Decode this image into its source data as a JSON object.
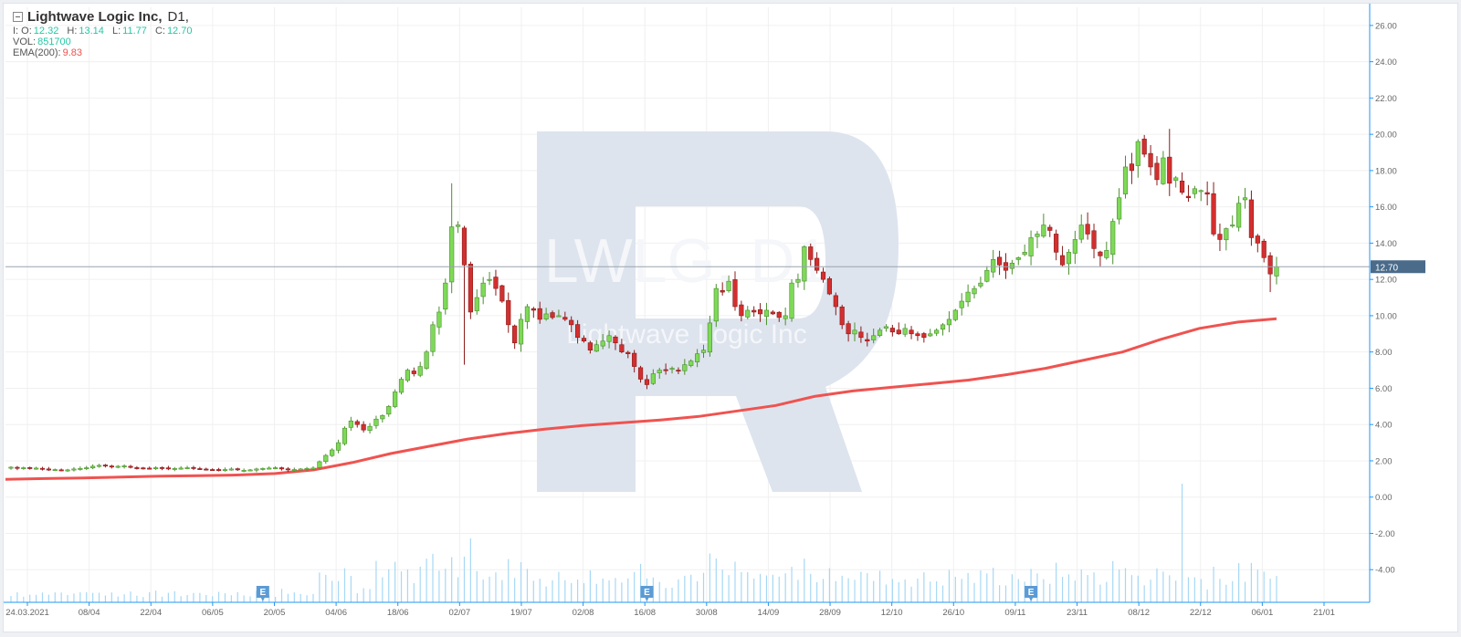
{
  "header": {
    "title": "Lightwave Logic Inc,",
    "timeframe": "D1,",
    "ohlc": {
      "o_label": "I: O:",
      "o": "12.32",
      "h_label": "H:",
      "h": "13.14",
      "l_label": "L:",
      "l": "11.77",
      "c_label": "C:",
      "c": "12.70"
    },
    "vol_label": "VOL:",
    "vol": "851700",
    "ema_label": "EMA(200):",
    "ema": "9.83"
  },
  "colors": {
    "up": "#7ed957",
    "down": "#d32f2f",
    "ema": "#ef5350",
    "volume": "#a6d8f5",
    "price_tag_bg": "#4a6b8a",
    "axis": "#2196f3",
    "grid": "#f0f0f0",
    "text_green": "#26c6a6",
    "text_red": "#ef5350"
  },
  "watermark": {
    "symbol": "LWLG, D1",
    "name": "Lightwave Logic Inc"
  },
  "event_markers": [
    {
      "label": "E",
      "date_index": 40
    },
    {
      "label": "E",
      "date_index": 101
    },
    {
      "label": "E",
      "date_index": 162
    }
  ],
  "chart_data": {
    "type": "candlestick",
    "series_name": "LWLG",
    "timeframe": "D1",
    "x_ticks": [
      "24.03.2021",
      "08/04",
      "22/04",
      "06/05",
      "20/05",
      "04/06",
      "18/06",
      "02/07",
      "19/07",
      "02/08",
      "16/08",
      "30/08",
      "14/09",
      "28/09",
      "12/10",
      "26/10",
      "09/11",
      "23/11",
      "08/12",
      "22/12",
      "06/01",
      "21/01"
    ],
    "y_ticks": [
      "26.00",
      "24.00",
      "22.00",
      "20.00",
      "18.00",
      "16.00",
      "14.00",
      "12.00",
      "10.00",
      "8.00",
      "6.00",
      "4.00",
      "2.00",
      "0.00",
      "-2.00",
      "-4.00"
    ],
    "ylim": [
      -5.8,
      27
    ],
    "last_price": "12.70",
    "last_price_value": 12.7,
    "closes": [
      1.65,
      1.6,
      1.62,
      1.58,
      1.6,
      1.55,
      1.5,
      1.52,
      1.48,
      1.5,
      1.55,
      1.58,
      1.62,
      1.7,
      1.75,
      1.72,
      1.68,
      1.7,
      1.72,
      1.65,
      1.62,
      1.6,
      1.58,
      1.62,
      1.6,
      1.55,
      1.58,
      1.6,
      1.62,
      1.58,
      1.55,
      1.52,
      1.5,
      1.48,
      1.52,
      1.55,
      1.5,
      1.48,
      1.5,
      1.55,
      1.58,
      1.6,
      1.62,
      1.55,
      1.5,
      1.52,
      1.55,
      1.58,
      1.6,
      1.95,
      2.3,
      2.6,
      3.0,
      3.8,
      4.2,
      4.0,
      3.7,
      3.9,
      4.3,
      4.5,
      5.0,
      5.8,
      6.5,
      7.0,
      6.8,
      7.2,
      8.0,
      9.5,
      10.2,
      11.8,
      14.9,
      15.0,
      12.8,
      10.2,
      11.0,
      11.8,
      12.0,
      11.5,
      10.8,
      9.5,
      8.5,
      9.8,
      10.5,
      10.3,
      9.8,
      10.1,
      9.9,
      10.0,
      9.8,
      9.5,
      8.8,
      8.6,
      8.1,
      8.4,
      8.6,
      8.9,
      8.5,
      8.0,
      7.9,
      7.2,
      6.5,
      6.2,
      6.8,
      7.0,
      7.0,
      7.1,
      7.0,
      7.3,
      7.5,
      7.9,
      8.1,
      9.6,
      11.5,
      11.3,
      11.9,
      10.5,
      10.0,
      10.3,
      10.2,
      10.1,
      10.3,
      10.1,
      9.9,
      10.0,
      11.8,
      12.0,
      13.8,
      13.1,
      12.5,
      12.0,
      11.2,
      10.5,
      9.5,
      9.0,
      9.2,
      8.8,
      8.6,
      8.9,
      9.2,
      9.4,
      9.1,
      9.0,
      9.3,
      9.0,
      8.9,
      8.8,
      9.0,
      9.2,
      9.5,
      9.8,
      10.3,
      10.8,
      11.3,
      11.5,
      11.8,
      12.5,
      13.1,
      12.8,
      12.5,
      12.9,
      13.2,
      13.5,
      14.3,
      14.5,
      15.0,
      14.7,
      13.5,
      12.8,
      13.5,
      14.2,
      15.0,
      14.5,
      13.7,
      13.3,
      13.6,
      15.2,
      16.5,
      18.2,
      18.0,
      19.6,
      18.9,
      18.2,
      17.5,
      18.7,
      17.3,
      17.6,
      16.8,
      16.5,
      17.0,
      16.9,
      16.7,
      14.5,
      14.2,
      14.8,
      15.0,
      16.2,
      16.5,
      14.3,
      14.0,
      13.2,
      12.3,
      12.7
    ],
    "ema200": [
      0.98,
      1.02,
      1.05,
      1.1,
      1.15,
      1.18,
      1.22,
      1.3,
      1.5,
      1.9,
      2.4,
      2.8,
      3.2,
      3.5,
      3.75,
      3.95,
      4.1,
      4.25,
      4.45,
      4.75,
      5.05,
      5.55,
      5.85,
      6.05,
      6.25,
      6.45,
      6.75,
      7.1,
      7.55,
      8.0,
      8.7,
      9.3,
      9.65,
      9.83
    ]
  }
}
